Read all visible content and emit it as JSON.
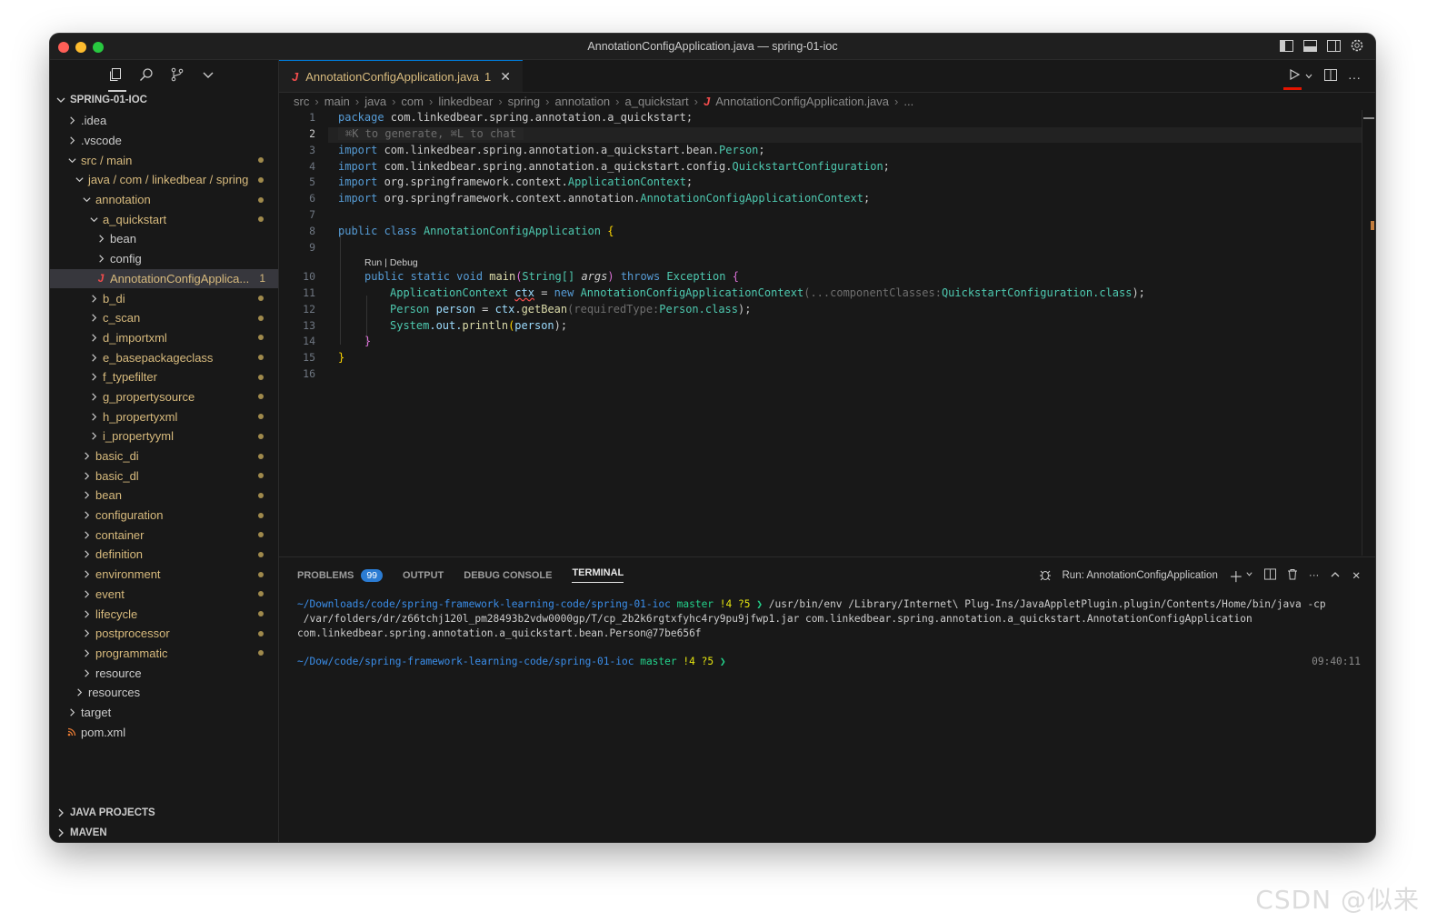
{
  "window": {
    "title": "AnnotationConfigApplication.java — spring-01-ioc"
  },
  "sidebar": {
    "root": "SPRING-01-IOC",
    "items": [
      {
        "label": ".idea",
        "indent": 0,
        "open": false,
        "color": "white",
        "dot": false
      },
      {
        "label": ".vscode",
        "indent": 0,
        "open": false,
        "color": "white",
        "dot": false
      },
      {
        "label": "src / main",
        "indent": 0,
        "open": true,
        "color": "gold",
        "dot": true
      },
      {
        "label": "java / com / linkedbear / spring",
        "indent": 1,
        "open": true,
        "color": "gold",
        "dot": true
      },
      {
        "label": "annotation",
        "indent": 2,
        "open": true,
        "color": "gold",
        "dot": true
      },
      {
        "label": "a_quickstart",
        "indent": 3,
        "open": true,
        "color": "gold",
        "dot": true
      },
      {
        "label": "bean",
        "indent": 4,
        "open": false,
        "color": "white",
        "dot": false
      },
      {
        "label": "config",
        "indent": 4,
        "open": false,
        "color": "white",
        "dot": false
      },
      {
        "label": "AnnotationConfigApplica...",
        "indent": 4,
        "file": "java",
        "color": "gold",
        "badge": "1",
        "selected": true
      },
      {
        "label": "b_di",
        "indent": 3,
        "open": false,
        "color": "gold",
        "dot": true
      },
      {
        "label": "c_scan",
        "indent": 3,
        "open": false,
        "color": "gold",
        "dot": true
      },
      {
        "label": "d_importxml",
        "indent": 3,
        "open": false,
        "color": "gold",
        "dot": true
      },
      {
        "label": "e_basepackageclass",
        "indent": 3,
        "open": false,
        "color": "gold",
        "dot": true
      },
      {
        "label": "f_typefilter",
        "indent": 3,
        "open": false,
        "color": "gold",
        "dot": true
      },
      {
        "label": "g_propertysource",
        "indent": 3,
        "open": false,
        "color": "gold",
        "dot": true
      },
      {
        "label": "h_propertyxml",
        "indent": 3,
        "open": false,
        "color": "gold",
        "dot": true
      },
      {
        "label": "i_propertyyml",
        "indent": 3,
        "open": false,
        "color": "gold",
        "dot": true
      },
      {
        "label": "basic_di",
        "indent": 2,
        "open": false,
        "color": "gold",
        "dot": true
      },
      {
        "label": "basic_dl",
        "indent": 2,
        "open": false,
        "color": "gold",
        "dot": true
      },
      {
        "label": "bean",
        "indent": 2,
        "open": false,
        "color": "gold",
        "dot": true
      },
      {
        "label": "configuration",
        "indent": 2,
        "open": false,
        "color": "gold",
        "dot": true
      },
      {
        "label": "container",
        "indent": 2,
        "open": false,
        "color": "gold",
        "dot": true
      },
      {
        "label": "definition",
        "indent": 2,
        "open": false,
        "color": "gold",
        "dot": true
      },
      {
        "label": "environment",
        "indent": 2,
        "open": false,
        "color": "gold",
        "dot": true
      },
      {
        "label": "event",
        "indent": 2,
        "open": false,
        "color": "gold",
        "dot": true
      },
      {
        "label": "lifecycle",
        "indent": 2,
        "open": false,
        "color": "gold",
        "dot": true
      },
      {
        "label": "postprocessor",
        "indent": 2,
        "open": false,
        "color": "gold",
        "dot": true
      },
      {
        "label": "programmatic",
        "indent": 2,
        "open": false,
        "color": "gold",
        "dot": true
      },
      {
        "label": "resource",
        "indent": 2,
        "open": false,
        "color": "white",
        "dot": false
      },
      {
        "label": "resources",
        "indent": 1,
        "open": false,
        "color": "white",
        "dot": false
      },
      {
        "label": "target",
        "indent": 0,
        "open": false,
        "color": "white",
        "dot": false
      },
      {
        "label": "pom.xml",
        "indent": 0,
        "file": "xml",
        "color": "white",
        "dot": false
      }
    ],
    "sections": [
      "JAVA PROJECTS",
      "MAVEN"
    ]
  },
  "editor": {
    "tab": {
      "label": "AnnotationConfigApplication.java",
      "problems": "1"
    },
    "breadcrumb": [
      "src",
      "main",
      "java",
      "com",
      "linkedbear",
      "spring",
      "annotation",
      "a_quickstart",
      "AnnotationConfigApplication.java",
      "..."
    ],
    "line_numbers": [
      "1",
      "2",
      "3",
      "4",
      "5",
      "6",
      "7",
      "8",
      "9",
      "10",
      "11",
      "12",
      "13",
      "14",
      "15",
      "16"
    ],
    "code": {
      "l1_kw": "package",
      "l1_rest": " com.linkedbear.spring.annotation.a_quickstart;",
      "l2_hint": "⌘K to generate, ⌘L to chat",
      "import_kw": "import",
      "l3_pkg": " com.linkedbear.spring.annotation.a_quickstart.bean.",
      "l3_cls": "Person",
      "l4_pkg": " com.linkedbear.spring.annotation.a_quickstart.config.",
      "l4_cls": "QuickstartConfiguration",
      "l5_pkg": " org.springframework.context.",
      "l5_cls": "ApplicationContext",
      "l6_pkg": " org.springframework.context.annotation.",
      "l6_cls": "AnnotationConfigApplicationContext",
      "semi": ";",
      "l8_kw": "public class",
      "l8_cls": "AnnotationConfigApplication",
      "l8_brace": "{",
      "codelens": "Run | Debug",
      "l10_kw": "public static void",
      "l10_fn": "main",
      "l10_p1": "(",
      "l10_type": "String[]",
      "l10_arg": "args",
      "l10_p2": ")",
      "l10_throws": "throws",
      "l10_exc": "Exception",
      "l10_brace": "{",
      "l11_type": "ApplicationContext",
      "l11_var": "ctx",
      "l11_eq": " = ",
      "l11_new": "new",
      "l11_cls": "AnnotationConfigApplicationContext",
      "l11_hint": "(...componentClasses:",
      "l11_arg": "QuickstartConfiguration.class",
      "l11_end": ");",
      "l12_type": "Person",
      "l12_var": "person",
      "l12_eq": " = ",
      "l12_obj": "ctx",
      "l12_dot": ".",
      "l12_fn": "getBean",
      "l12_hint": "(requiredType:",
      "l12_arg": "Person.class",
      "l12_end": ");",
      "l13_sys": "System",
      "l13_out": ".out.",
      "l13_fn": "println",
      "l13_p1": "(",
      "l13_arg": "person",
      "l13_end": ");",
      "l14_brace": "}",
      "l15_brace": "}"
    }
  },
  "panel": {
    "tabs": [
      {
        "label": "PROBLEMS",
        "badge": "99"
      },
      {
        "label": "OUTPUT"
      },
      {
        "label": "DEBUG CONSOLE"
      },
      {
        "label": "TERMINAL",
        "active": true
      }
    ],
    "run_label": "Run: AnnotationConfigApplication",
    "terminal": {
      "line1_path": "~/Downloads/code/spring-framework-learning-code/spring-01-ioc",
      "line1_branch": "master",
      "line1_status": "!4 ?5",
      "line1_prompt": "❯",
      "line1_cmd": " /usr/bin/env /Library/Internet\\ Plug-Ins/JavaAppletPlugin.plugin/Contents/Home/bin/java -cp",
      "line2": " /var/folders/dr/z66tchj120l_pm28493b2vdw0000gp/T/cp_2b2k6rgtxfyhc4ry9pu9jfwp1.jar com.linkedbear.spring.annotation.a_quickstart.AnnotationConfigApplication",
      "line3": "com.linkedbear.spring.annotation.a_quickstart.bean.Person@77be656f",
      "line4_path": "~/Dow/code/spring-framework-learning-code/spring-01-ioc",
      "line4_branch": "master",
      "line4_status": "!4 ?5",
      "line4_prompt": "❯",
      "time": "09:40:11"
    }
  },
  "watermark": "CSDN @似来",
  "colors": {
    "accent": "#0078d4",
    "folder_modified": "#d7ba7d",
    "error": "#f14c4c"
  }
}
